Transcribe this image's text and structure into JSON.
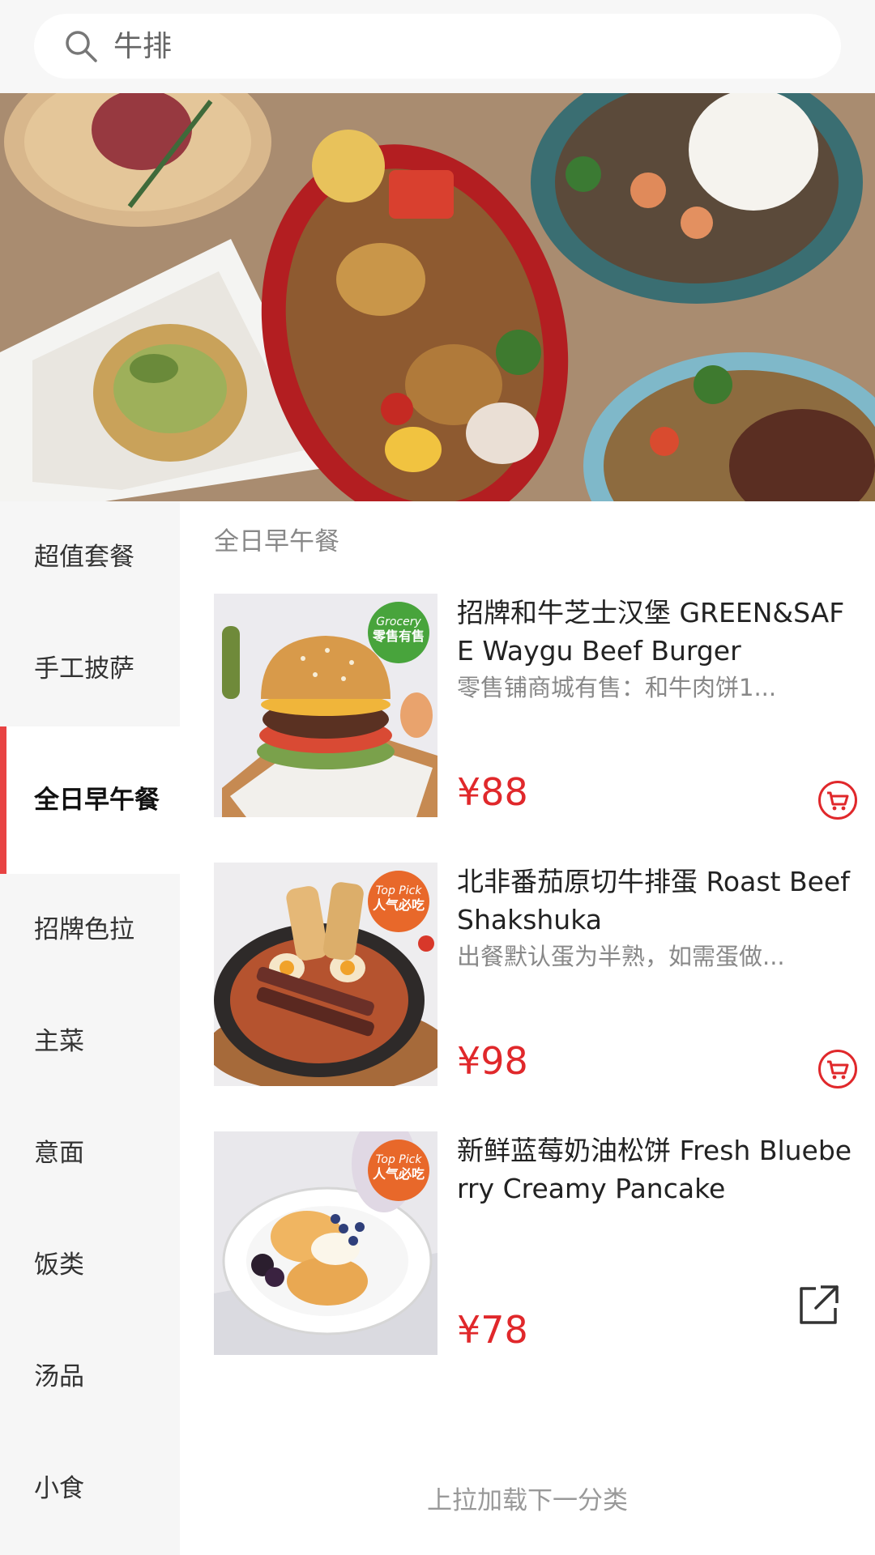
{
  "search": {
    "placeholder": "牛排"
  },
  "sidebar": {
    "items": [
      {
        "label": "超值套餐"
      },
      {
        "label": "手工披萨"
      },
      {
        "label": "全日早午餐",
        "active": true
      },
      {
        "label": "招牌色拉"
      },
      {
        "label": "主菜"
      },
      {
        "label": "意面"
      },
      {
        "label": "饭类"
      },
      {
        "label": "汤品"
      },
      {
        "label": "小食"
      }
    ]
  },
  "section": {
    "title": "全日早午餐"
  },
  "products": [
    {
      "name": "招牌和牛芝士汉堡 GREEN&SAFE Waygu Beef Burger",
      "desc": "零售铺商城有售：和牛肉饼1...",
      "price": "¥88",
      "badge_line1": "Grocery",
      "badge_line2": "零售有售"
    },
    {
      "name": "北非番茄原切牛排蛋 Roast Beef Shakshuka",
      "desc": "出餐默认蛋为半熟，如需蛋做...",
      "price": "¥98",
      "badge_line1": "Top Pick",
      "badge_line2": "人气必吃"
    },
    {
      "name": "新鲜蓝莓奶油松饼 Fresh Blueberry Creamy Pancake",
      "desc": "",
      "price": "¥78",
      "badge_line1": "Top Pick",
      "badge_line2": "人气必吃"
    }
  ],
  "load_more": "上拉加载下一分类",
  "colors": {
    "accent": "#e84343",
    "price": "#e0282b"
  },
  "icons": {
    "search": "search-icon",
    "cart": "cart-icon",
    "share": "share-icon"
  }
}
